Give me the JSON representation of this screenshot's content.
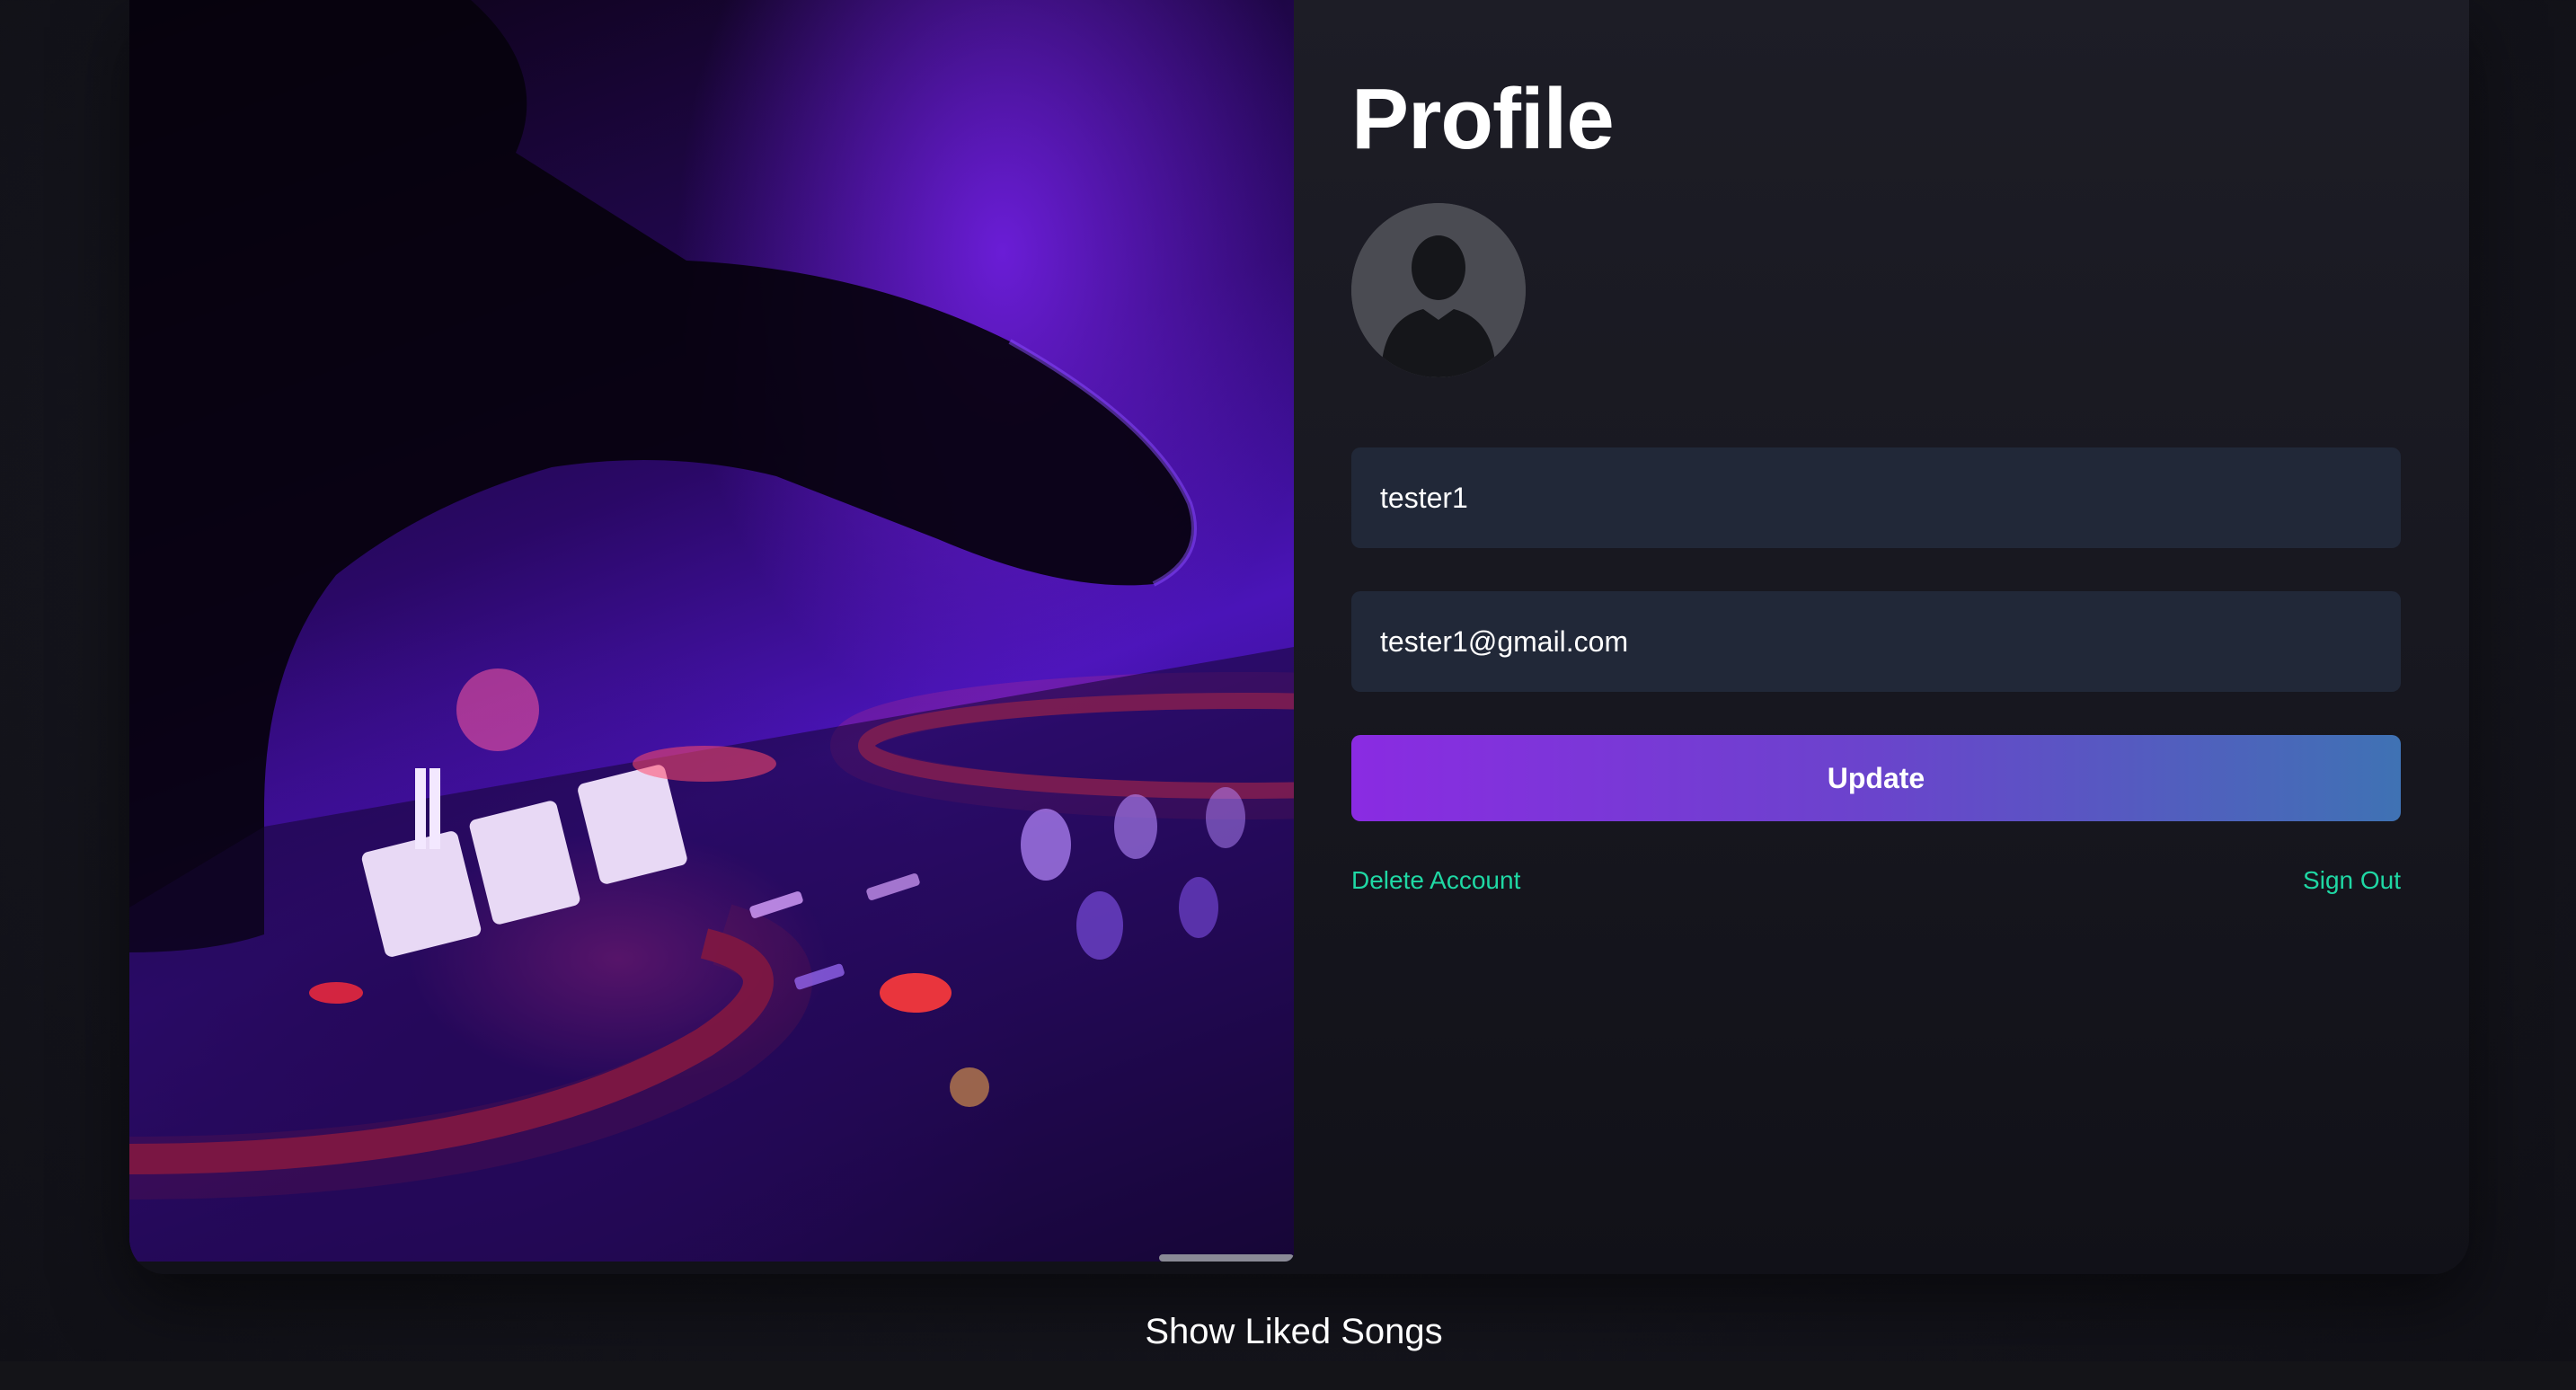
{
  "profile": {
    "title": "Profile",
    "username_value": "tester1",
    "email_value": "tester1@gmail.com",
    "update_label": "Update",
    "delete_account_label": "Delete Account",
    "sign_out_label": "Sign Out"
  },
  "liked_songs": {
    "label": "Show Liked Songs"
  },
  "icons": {
    "avatar": "user-silhouette-icon"
  },
  "colors": {
    "background": "#15151d",
    "card": "#1b1b24",
    "input_background": "#212838",
    "button_gradient_start": "#8a2be2",
    "button_gradient_end": "#3f72b4",
    "link": "#1fd8a4",
    "avatar_background": "#4a4b52",
    "avatar_figure": "#15161a"
  }
}
